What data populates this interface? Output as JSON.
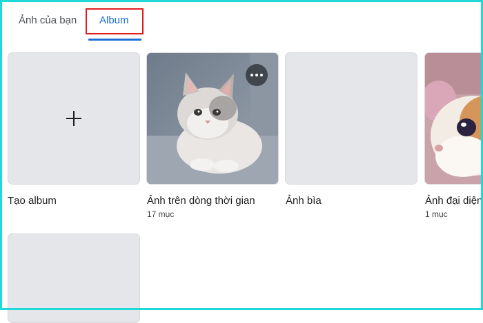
{
  "tabs": {
    "photos_label": "Ảnh của bạn",
    "album_label": "Album"
  },
  "albums": [
    {
      "title": "Tạo album",
      "icon": "plus-icon"
    },
    {
      "title": "Ảnh trên dòng thời gian",
      "count": "17 mục",
      "image": "kitten-photo"
    },
    {
      "title": "Ảnh bìa"
    },
    {
      "title": "Ảnh đại diện",
      "count": "1 mục",
      "image": "cat-closeup-photo"
    }
  ],
  "colors": {
    "accent": "#1b6fd6",
    "highlight_box": "#e01b1b",
    "frame_border": "#1fd8d8",
    "tile_placeholder": "#e5e6ea"
  }
}
